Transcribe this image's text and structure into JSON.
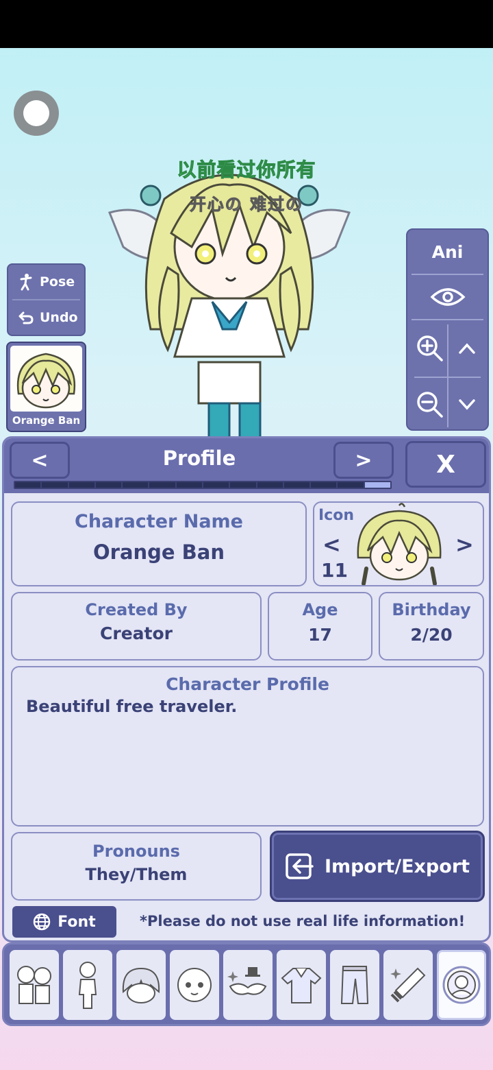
{
  "scene": {
    "caption_line1": "以前看过你所有",
    "caption_line2": "开心の 难过の"
  },
  "left_panel": {
    "pose_label": "Pose",
    "undo_label": "Undo",
    "thumbnail_label": "Orange Ban"
  },
  "right_panel": {
    "ani_label": "Ani"
  },
  "profile": {
    "title": "Profile",
    "prev": "<",
    "next": ">",
    "close": "X",
    "progress_filled_fraction": 0.07,
    "character_name_label": "Character Name",
    "character_name": "Orange Ban",
    "icon_label": "Icon",
    "icon_number": "11",
    "icon_prev": "<",
    "icon_next": ">",
    "created_by_label": "Created By",
    "created_by": "Creator",
    "age_label": "Age",
    "age": "17",
    "birthday_label": "Birthday",
    "birthday": "2/20",
    "character_profile_label": "Character Profile",
    "character_profile": "Beautiful free traveler.",
    "pronouns_label": "Pronouns",
    "pronouns": "They/Them",
    "import_export_label": "Import/Export",
    "font_label": "Font",
    "warning": "*Please do not use real life information!"
  },
  "toolbar": {
    "items": [
      "presets-icon",
      "body-icon",
      "hair-icon",
      "face-icon",
      "accessories-icon",
      "top-icon",
      "bottom-icon",
      "props-icon",
      "profile-icon"
    ],
    "active": "profile-icon"
  },
  "colors": {
    "panel": "#6a6ead",
    "panel_dark": "#4a4f8e",
    "card_bg": "#e4e5f5",
    "label_text": "#5a6bac",
    "value_text": "#3a4276",
    "caption_green": "#6ed07b"
  }
}
